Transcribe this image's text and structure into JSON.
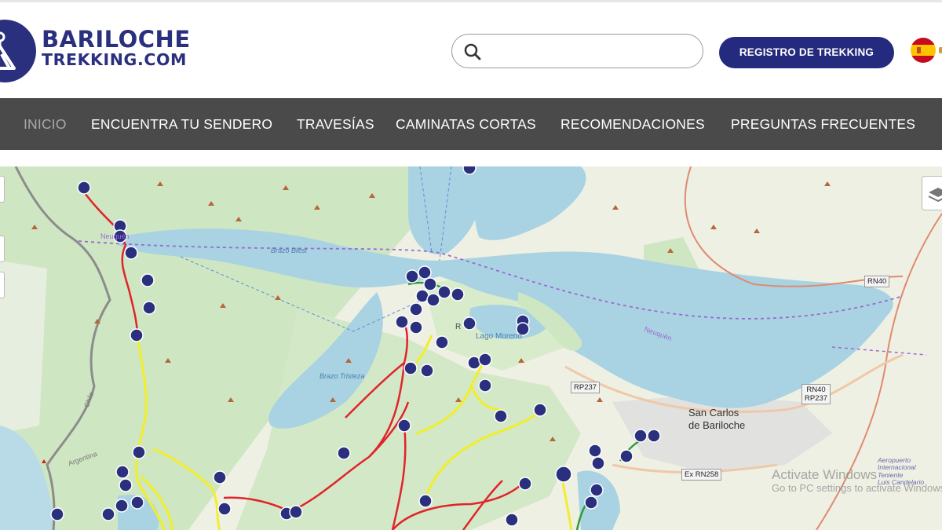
{
  "brand": {
    "name_line1": "BARILOCHE",
    "name_line2": "TREKKING.COM",
    "color": "#2a2f7e"
  },
  "header": {
    "search_placeholder": "",
    "search_icon": "search-icon",
    "register_label": "REGISTRO DE TREKKING",
    "language_flag": "spain-flag-icon"
  },
  "nav": {
    "items": [
      {
        "label": "INICIO",
        "active": true
      },
      {
        "label": "ENCUENTRA TU SENDERO",
        "active": false
      },
      {
        "label": "TRAVESÍAS",
        "active": false
      },
      {
        "label": "CAMINATAS CORTAS",
        "active": false
      },
      {
        "label": "RECOMENDACIONES",
        "active": false
      },
      {
        "label": "PREGUNTAS FRECUENTES",
        "active": false
      }
    ]
  },
  "map": {
    "places": {
      "city": "San Carlos\nde Bariloche",
      "lago_moreno": "Lago Moreno",
      "brazo_blest": "Brazo Blest",
      "brazo_tristeza": "Brazo Tristeza",
      "neuquen_1": "Neuquén",
      "neuquen_2": "Neuquén",
      "chile": "Chile",
      "argentina": "Argentina",
      "airport": "Aeropuerto\nInternacional\nTeniente\nLuis Candelario",
      "rd_label": "R"
    },
    "road_shields": {
      "rn40_top": "RN40",
      "rp237": "RP237",
      "rn40_rp237": "RN40\nRP237",
      "ex_rn258": "Ex RN258"
    },
    "colors": {
      "water": "#a9d3e2",
      "land": "#eef0e4",
      "forest": "#cde7c1",
      "trail_red": "#e0242b",
      "trail_yellow": "#f2ee2a",
      "trail_green": "#2e9c3a",
      "marker": "#2a2f7e"
    },
    "watermark": {
      "title": "Activate Windows",
      "subtitle": "Go to PC settings to activate Windows."
    }
  }
}
